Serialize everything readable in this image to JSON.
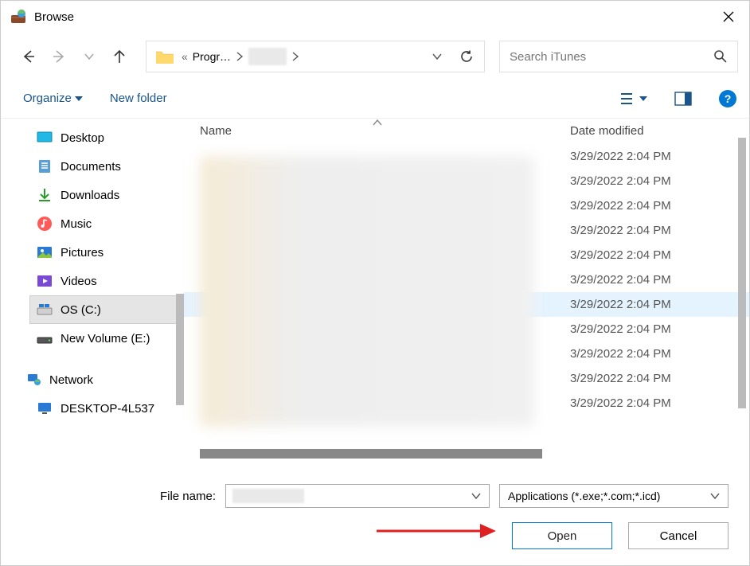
{
  "window": {
    "title": "Browse"
  },
  "address": {
    "crumbs": [
      {
        "label": "Progr…",
        "collapsed": false
      },
      {
        "label": "",
        "collapsed": true
      }
    ],
    "prefix": "«"
  },
  "search": {
    "placeholder": "Search iTunes"
  },
  "toolbar": {
    "organize_label": "Organize",
    "newfolder_label": "New folder"
  },
  "sidebar": {
    "items": [
      {
        "label": "Desktop",
        "icon": "desktop",
        "level": 1
      },
      {
        "label": "Documents",
        "icon": "documents",
        "level": 1
      },
      {
        "label": "Downloads",
        "icon": "downloads",
        "level": 1
      },
      {
        "label": "Music",
        "icon": "music",
        "level": 1
      },
      {
        "label": "Pictures",
        "icon": "pictures",
        "level": 1
      },
      {
        "label": "Videos",
        "icon": "videos",
        "level": 1
      },
      {
        "label": "OS (C:)",
        "icon": "drive",
        "level": 1,
        "selected": true
      },
      {
        "label": "New Volume (E:)",
        "icon": "drive-dark",
        "level": 1
      },
      {
        "label": "Network",
        "icon": "network",
        "level": 0
      },
      {
        "label": "DESKTOP-4L537",
        "icon": "monitor",
        "level": 1
      }
    ]
  },
  "columns": {
    "name": "Name",
    "date": "Date modified"
  },
  "files": [
    {
      "date": "3/29/2022 2:04 PM"
    },
    {
      "date": "3/29/2022 2:04 PM"
    },
    {
      "date": "3/29/2022 2:04 PM"
    },
    {
      "date": "3/29/2022 2:04 PM"
    },
    {
      "date": "3/29/2022 2:04 PM"
    },
    {
      "date": "3/29/2022 2:04 PM"
    },
    {
      "date": "3/29/2022 2:04 PM",
      "selhint": true
    },
    {
      "date": "3/29/2022 2:04 PM"
    },
    {
      "date": "3/29/2022 2:04 PM"
    },
    {
      "date": "3/29/2022 2:04 PM"
    },
    {
      "date": "3/29/2022 2:04 PM"
    }
  ],
  "footer": {
    "filename_label": "File name:",
    "filter_label": "Applications (*.exe;*.com;*.icd)",
    "open_label": "Open",
    "cancel_label": "Cancel"
  }
}
